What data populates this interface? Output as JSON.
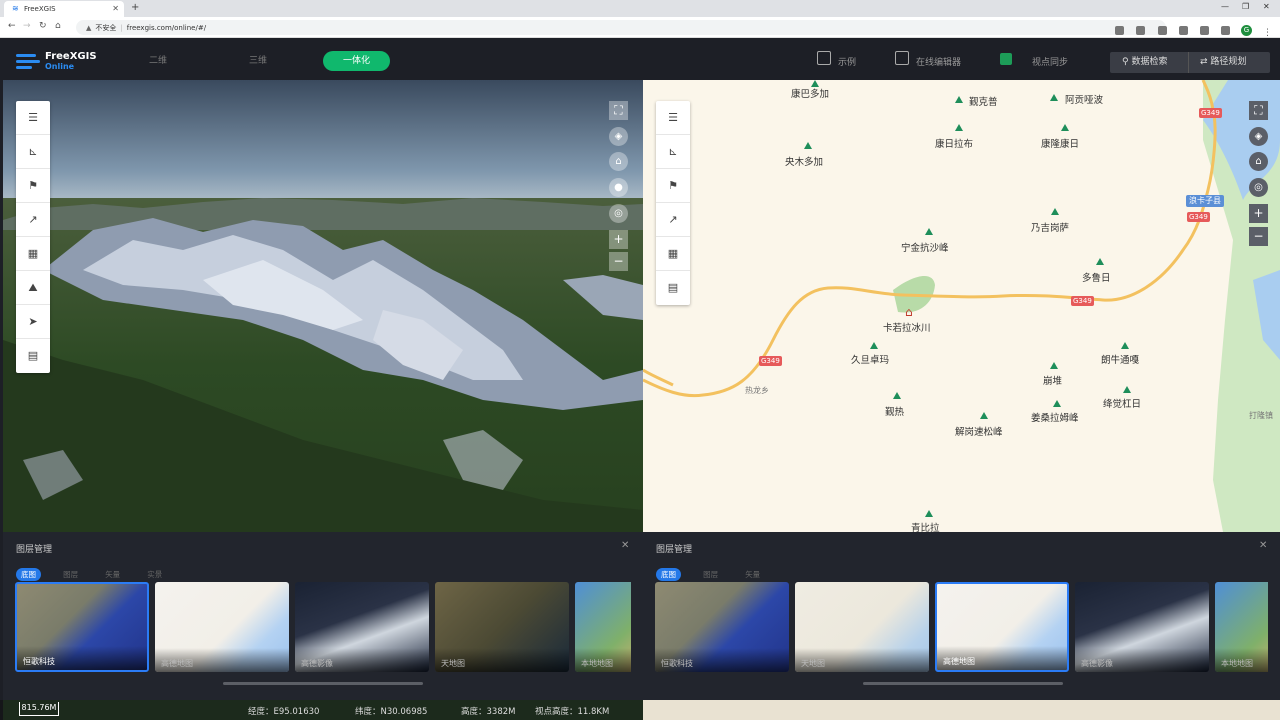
{
  "browser": {
    "tab_title": "FreeXGIS",
    "url_warning": "不安全",
    "url": "freexgis.com/online/#/"
  },
  "app": {
    "logo_top": "FreeXGIS",
    "logo_bottom": "Online",
    "modes": [
      "二维",
      "三维",
      "一体化"
    ],
    "active_mode": "一体化",
    "examples_label": "示例",
    "editor_label": "在线编辑器",
    "sync_label": "视点同步",
    "data_search_label": "数据检索",
    "route_plan_label": "路径规划",
    "accent_color": "#10b86d"
  },
  "map2d": {
    "places": [
      "康巴多加",
      "觐克普",
      "阿贡哑波",
      "康日拉布",
      "康隆康日",
      "央木多加",
      "宁金抗沙峰",
      "乃吉岗萨",
      "多鲁日",
      "卡若拉冰川",
      "久旦卓玛",
      "朗牛通嘎",
      "崩堆",
      "热龙乡",
      "觐热",
      "绛觉杠日",
      "姜桑拉姆峰",
      "解岗速松峰",
      "青比拉",
      "打隆镇"
    ],
    "roads": [
      "G349",
      "G349",
      "G349",
      "G349"
    ],
    "county": "浪卡子县"
  },
  "layers_left": {
    "title": "图层管理",
    "tabs": [
      "底图",
      "图层",
      "矢量",
      "实景"
    ],
    "thumbs": [
      "恒歌科技",
      "高德地图",
      "高德影像",
      "天地图",
      "本地地图"
    ]
  },
  "layers_right": {
    "title": "图层管理",
    "tabs": [
      "底图",
      "图层",
      "矢量"
    ],
    "thumbs": [
      "恒歌科技",
      "天地图",
      "高德地图",
      "高德影像",
      "本地地图"
    ]
  },
  "status": {
    "scale": "815.76M",
    "lon": "经度：E95.01630",
    "lat": "纬度：N30.06985",
    "height": "高度：3382M",
    "view_height": "视点高度：11.8KM"
  }
}
